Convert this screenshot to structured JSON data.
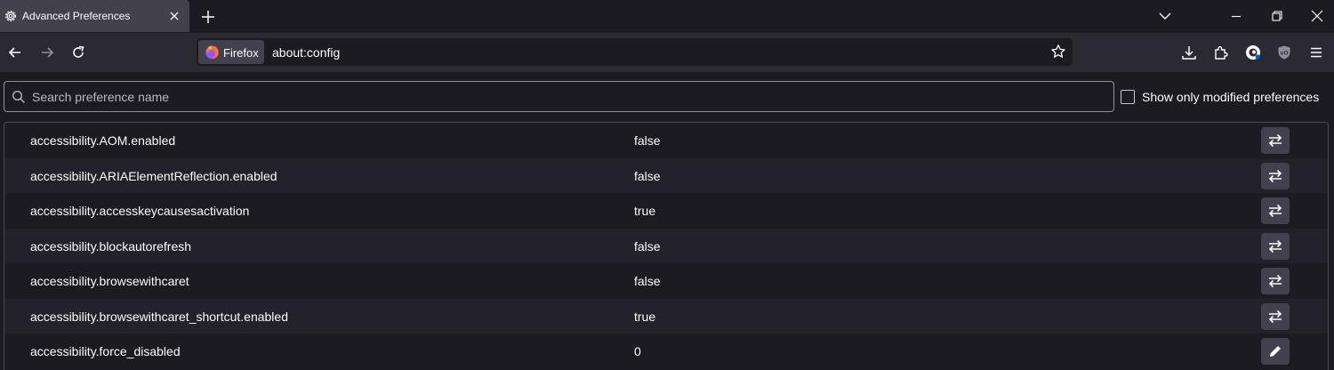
{
  "tab": {
    "title": "Advanced Preferences"
  },
  "urlbar": {
    "identity_label": "Firefox",
    "url": "about:config"
  },
  "search": {
    "placeholder": "Search preference name"
  },
  "modified_toggle": {
    "label": "Show only modified preferences",
    "checked": false
  },
  "preferences": [
    {
      "name": "accessibility.AOM.enabled",
      "value": "false",
      "action": "toggle"
    },
    {
      "name": "accessibility.ARIAElementReflection.enabled",
      "value": "false",
      "action": "toggle"
    },
    {
      "name": "accessibility.accesskeycausesactivation",
      "value": "true",
      "action": "toggle"
    },
    {
      "name": "accessibility.blockautorefresh",
      "value": "false",
      "action": "toggle"
    },
    {
      "name": "accessibility.browsewithcaret",
      "value": "false",
      "action": "toggle"
    },
    {
      "name": "accessibility.browsewithcaret_shortcut.enabled",
      "value": "true",
      "action": "toggle"
    },
    {
      "name": "accessibility.force_disabled",
      "value": "0",
      "action": "edit"
    }
  ],
  "icons": {
    "tab": "gear-icon",
    "tab_close": "close-icon",
    "new_tab": "plus-icon",
    "back": "back-arrow-icon",
    "forward": "forward-arrow-icon",
    "reload": "reload-icon",
    "bookmark": "star-icon",
    "toggle": "toggle-arrows-icon",
    "edit": "pencil-icon"
  },
  "colors": {
    "background": "#1c1b22",
    "toolbar": "#2b2a33",
    "button": "#42414d",
    "text": "#fbfbfe"
  }
}
